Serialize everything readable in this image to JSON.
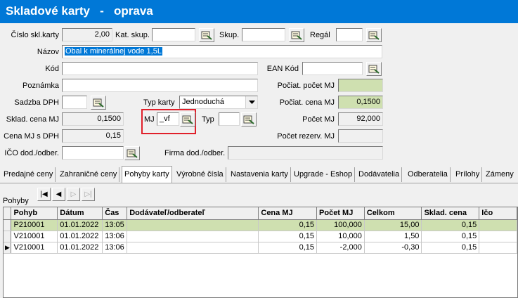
{
  "window": {
    "title": "Skladové karty   -   oprava"
  },
  "form": {
    "cislo_label": "Číslo skl.karty",
    "cislo_value": "2,00",
    "kat_label": "Kat. skup.",
    "kat_value": "",
    "skup_label": "Skup.",
    "skup_value": "",
    "regal_label": "Regál",
    "regal_value": "",
    "nazov_label": "Názov",
    "nazov_value": "Obal k minerálnej vode 1,5L",
    "kod_label": "Kód",
    "kod_value": "",
    "ean_label": "EAN Kód",
    "ean_value": "",
    "poznamka_label": "Poznámka",
    "poznamka_value": "",
    "pociat_pocet_label": "Počiat. počet MJ",
    "pociat_pocet_value": "",
    "sadzba_label": "Sadzba DPH",
    "sadzba_value": "",
    "typ_karty_label": "Typ karty",
    "typ_karty_value": "Jednoduchá",
    "pociat_cena_label": "Počiat. cena MJ",
    "pociat_cena_value": "0,1500",
    "sklad_cena_label": "Sklad. cena MJ",
    "sklad_cena_value": "0,1500",
    "mj_label": "MJ",
    "mj_value": "_vf",
    "typ_label": "Typ",
    "typ_value": "",
    "pocet_label": "Počet MJ",
    "pocet_value": "92,000",
    "cena_dph_label": "Cena MJ s DPH",
    "cena_dph_value": "0,15",
    "rezerv_label": "Počet rezerv. MJ",
    "rezerv_value": "",
    "ico_label": "IČO dod./odber.",
    "ico_value": "",
    "firma_label": "Firma dod./odber.",
    "firma_value": ""
  },
  "tabs": [
    "Predajné ceny",
    "Zahraničné ceny",
    "Pohyby karty",
    "Výrobné čísla",
    "Nastavenia karty",
    "Upgrade - Eshop",
    "Dodávatelia",
    "Odberatelia",
    "Prílohy",
    "Zámeny"
  ],
  "active_tab": "Pohyby karty",
  "pohyby": {
    "label": "Pohyby",
    "nav": [
      "first",
      "prev",
      "next",
      "last"
    ],
    "columns": [
      "Pohyb",
      "Dátum",
      "Čas",
      "Dodávateľ/odberateľ",
      "Cena MJ",
      "Počet MJ",
      "Celkom",
      "Sklad. cena",
      "Ičo"
    ],
    "rows": [
      [
        "P210001",
        "01.01.2022",
        "13:05",
        "",
        "0,15",
        "100,000",
        "15,00",
        "0,15",
        ""
      ],
      [
        "V210001",
        "01.01.2022",
        "13:06",
        "",
        "0,15",
        "10,000",
        "1,50",
        "0,15",
        ""
      ],
      [
        "V210001",
        "01.01.2022",
        "13:06",
        "",
        "0,15",
        "-2,000",
        "-0,30",
        "0,15",
        ""
      ]
    ],
    "selected_row": 0,
    "pointer_row": 2
  },
  "colors": {
    "title_bar": "#0078d7",
    "highlight_green": "#cfe0b0",
    "annotation_red": "#e0202a"
  }
}
